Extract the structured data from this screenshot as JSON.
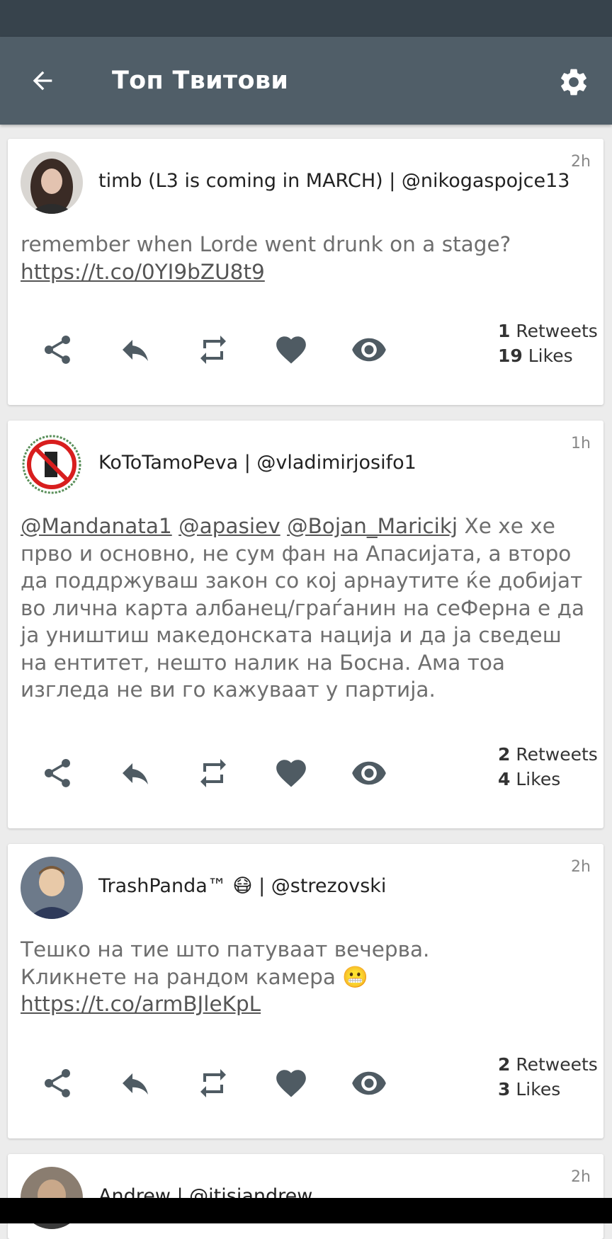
{
  "app_bar": {
    "title": "Топ Твитови",
    "back_icon": "arrow-back-icon",
    "settings_icon": "gear-icon"
  },
  "colors": {
    "status_bar": "#37434c",
    "app_bar": "#505e68",
    "background": "#ececec",
    "icon": "#4f5b63"
  },
  "tweets": [
    {
      "author": "timb (L3 is coming in MARCH) | @nikogaspojce13",
      "time": "2h",
      "text_line1": "remember when Lorde went drunk on a stage?",
      "link": "https://t.co/0YI9bZU8t9",
      "retweets_count": "1",
      "retweets_label": "Retweets",
      "likes_count": "19",
      "likes_label": "Likes"
    },
    {
      "author": "KoToTamoPeva | @vladimirjosifo1",
      "time": "1h",
      "mention1": "@Mandanata1",
      "mention2": "@apasiev",
      "mention3": "@Bojan_Maricikj",
      "text": "Хе хе хе прво и основно, не сум фан на Апасијата, а второ да поддржуваш закон со кој арнаутите ќе добијат во лична карта албанец/граѓанин на сеФерна е да ја уништиш македонската нација и да ја сведеш на ентитет, нешто налик на Босна. Ама тоа изгледа не ви го кажуваат у партија.",
      "retweets_count": "2",
      "retweets_label": "Retweets",
      "likes_count": "4",
      "likes_label": "Likes"
    },
    {
      "author": "TrashPanda™ 😷 | @strezovski",
      "time": "2h",
      "text_line1": "Тешко на тие што патуваат вечерва.",
      "text_line2": "Кликнете на рандом камера 😬",
      "link": "https://t.co/armBJleKpL",
      "retweets_count": "2",
      "retweets_label": "Retweets",
      "likes_count": "3",
      "likes_label": "Likes"
    },
    {
      "author": "Andrew | @itisjandrew",
      "time": "2h"
    }
  ],
  "action_icons": [
    "share-icon",
    "reply-icon",
    "retweet-icon",
    "heart-icon",
    "eye-icon"
  ]
}
